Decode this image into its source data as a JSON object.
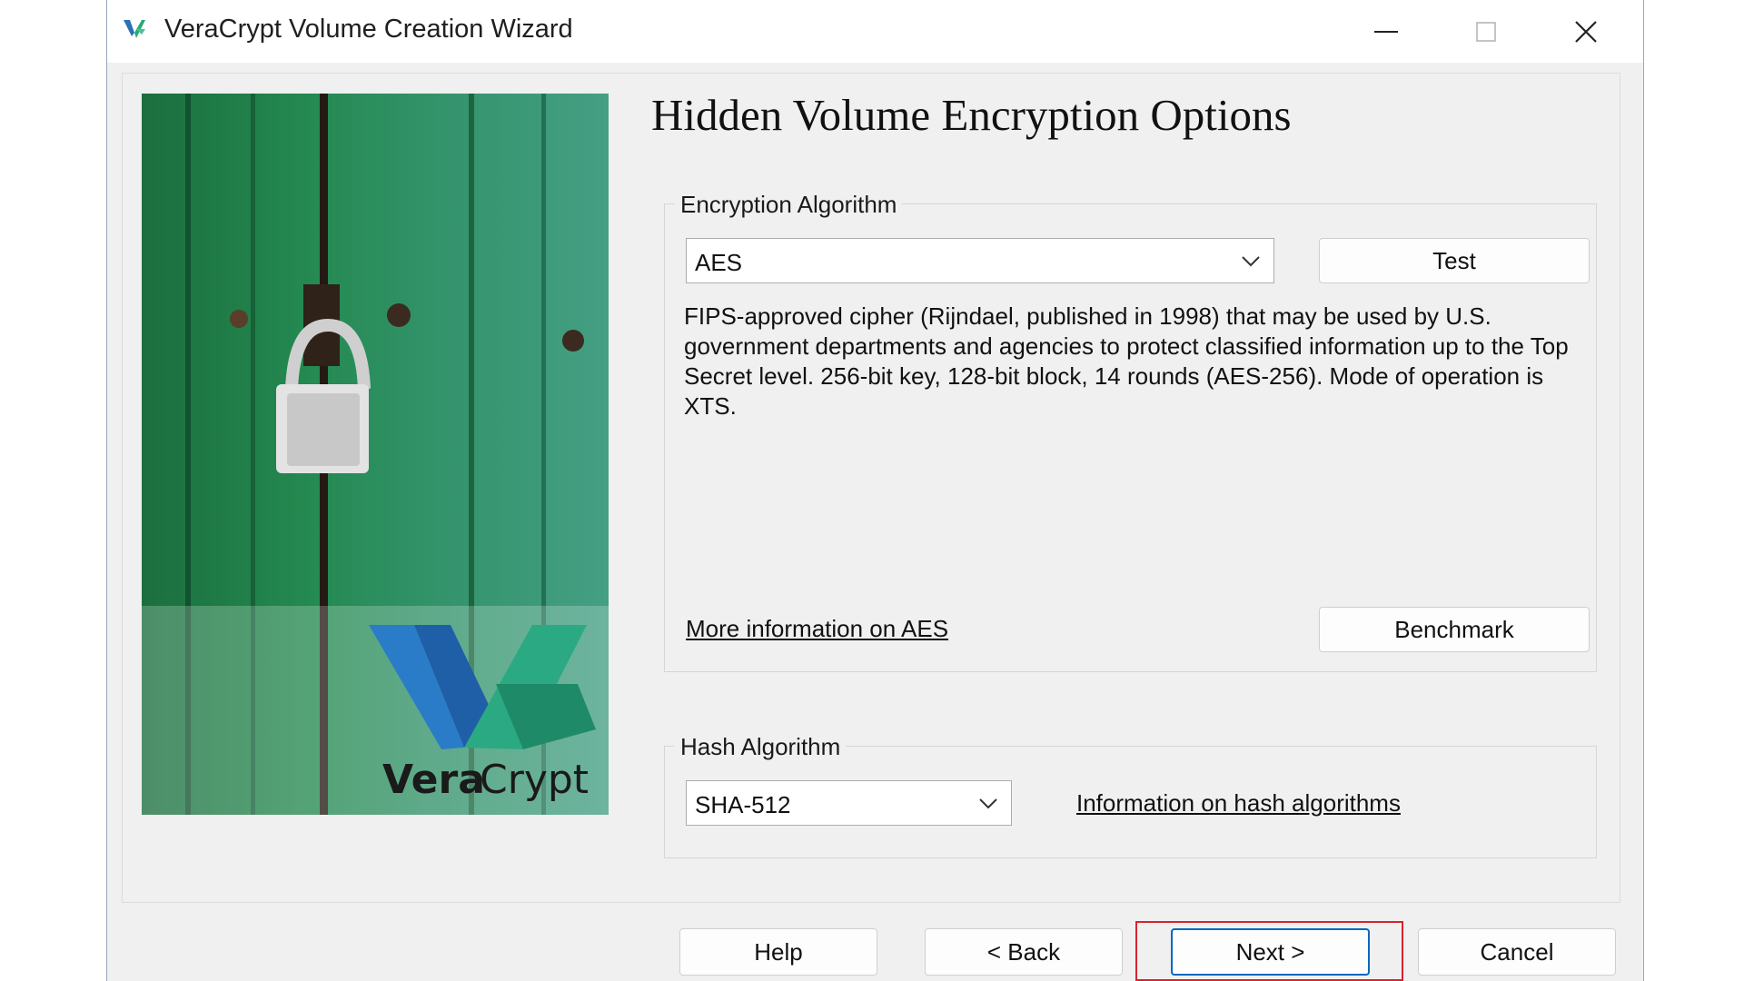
{
  "window": {
    "title": "VeraCrypt Volume Creation Wizard"
  },
  "page": {
    "title": "Hidden Volume Encryption Options"
  },
  "encryption": {
    "group_label": "Encryption Algorithm",
    "selected": "AES",
    "test_button": "Test",
    "description": "FIPS-approved cipher (Rijndael, published in 1998) that may be used by U.S. government departments and agencies to protect classified information up to the Top Secret level. 256-bit key, 128-bit block, 14 rounds (AES-256). Mode of operation is XTS.",
    "more_info_link": "More information on AES",
    "benchmark_button": "Benchmark"
  },
  "hash": {
    "group_label": "Hash Algorithm",
    "selected": "SHA-512",
    "info_link": "Information on hash algorithms"
  },
  "buttons": {
    "help": "Help",
    "back": "< Back",
    "next": "Next >",
    "cancel": "Cancel"
  },
  "logo": {
    "text_bold": "Vera",
    "text_light": "Crypt"
  },
  "colors": {
    "highlight": "#d9232d",
    "accent_blue": "#0067c0",
    "image_green": "#2e8b57"
  }
}
